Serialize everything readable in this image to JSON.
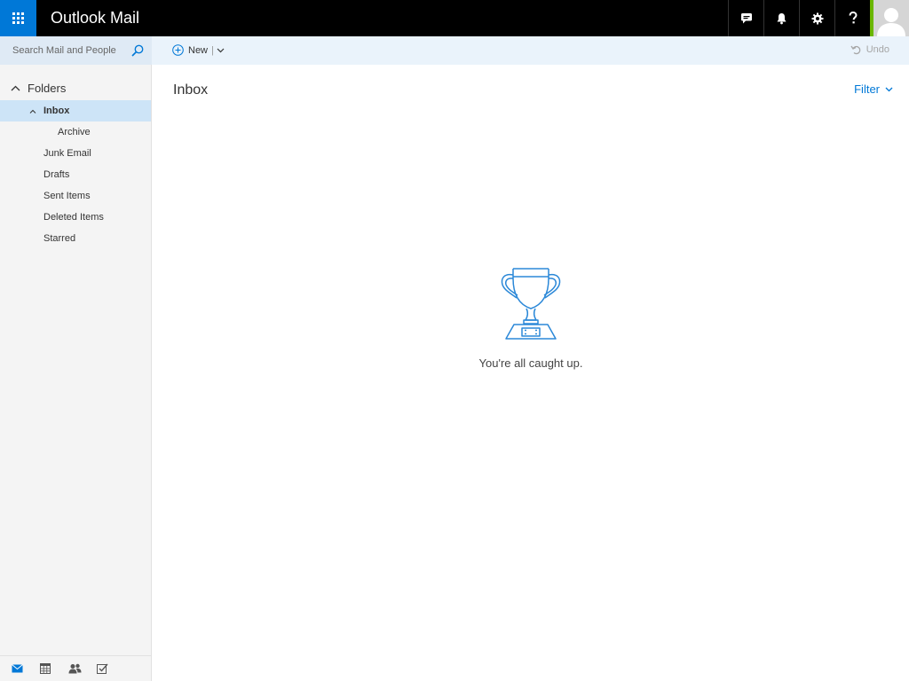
{
  "app": {
    "title": "Outlook Mail"
  },
  "topbar": {
    "icons": [
      "app-launcher-icon",
      "chat-icon",
      "bell-icon",
      "gear-icon",
      "help-icon",
      "avatar-icon"
    ],
    "accent": "#0078d7",
    "presence": "#6bb700"
  },
  "search": {
    "placeholder": "Search Mail and People"
  },
  "toolbar": {
    "new_label": "New",
    "separator": "|",
    "undo_label": "Undo"
  },
  "sidebar": {
    "folders_label": "Folders",
    "items": [
      {
        "label": "Inbox",
        "selected": true
      },
      {
        "label": "Archive"
      },
      {
        "label": "Junk Email"
      },
      {
        "label": "Drafts"
      },
      {
        "label": "Sent Items"
      },
      {
        "label": "Deleted Items"
      },
      {
        "label": "Starred"
      }
    ],
    "bottom_nav": [
      "mail-icon",
      "calendar-icon",
      "people-icon",
      "tasks-icon"
    ]
  },
  "main": {
    "title": "Inbox",
    "filter_label": "Filter",
    "empty_message": "You're all caught up."
  }
}
